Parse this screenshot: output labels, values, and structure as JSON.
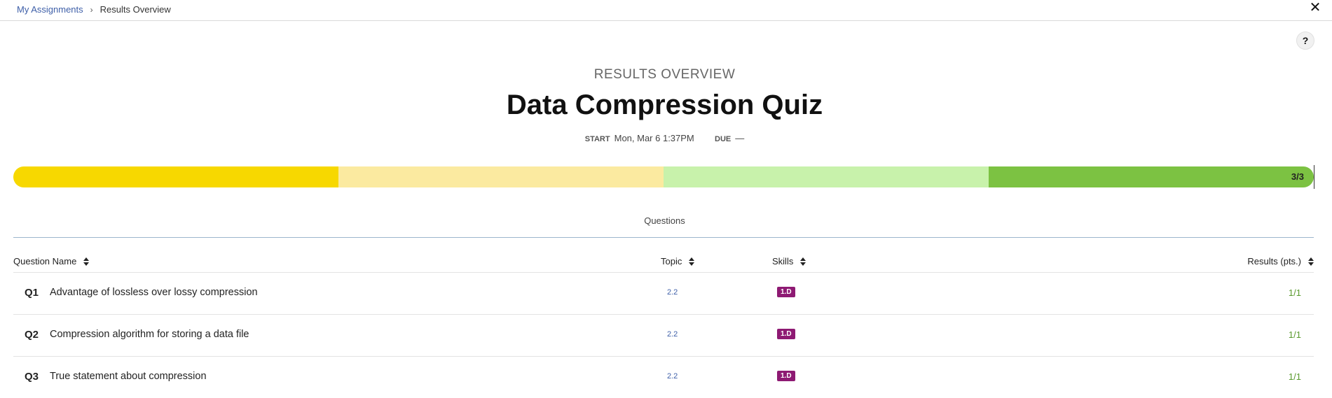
{
  "breadcrumb": {
    "parent": "My Assignments",
    "separator": "›",
    "current": "Results Overview"
  },
  "controls": {
    "close": "✕",
    "help": "?"
  },
  "header": {
    "overline": "RESULTS OVERVIEW",
    "title": "Data Compression Quiz",
    "start_label": "START",
    "start_value": "Mon, Mar 6 1:37PM",
    "due_label": "DUE",
    "due_value": "—"
  },
  "progress": {
    "score_text": "3/3",
    "score": 3,
    "total": 3,
    "segment_colors": [
      "#f7d800",
      "#fbeaa0",
      "#c8f2ab",
      "#7cc242"
    ]
  },
  "tabs": {
    "questions": "Questions"
  },
  "table": {
    "headers": {
      "name": "Question Name",
      "topic": "Topic",
      "skills": "Skills",
      "results": "Results (pts.)"
    },
    "rows": [
      {
        "num": "Q1",
        "name": "Advantage of lossless over lossy compression",
        "topic": "2.2",
        "skill": "1.D",
        "result": "1/1"
      },
      {
        "num": "Q2",
        "name": "Compression algorithm for storing a data file",
        "topic": "2.2",
        "skill": "1.D",
        "result": "1/1"
      },
      {
        "num": "Q3",
        "name": "True statement about compression",
        "topic": "2.2",
        "skill": "1.D",
        "result": "1/1"
      }
    ]
  },
  "colors": {
    "link": "#3e5fa8",
    "skill_badge": "#8e1a73",
    "result_text": "#5a9a2e"
  }
}
